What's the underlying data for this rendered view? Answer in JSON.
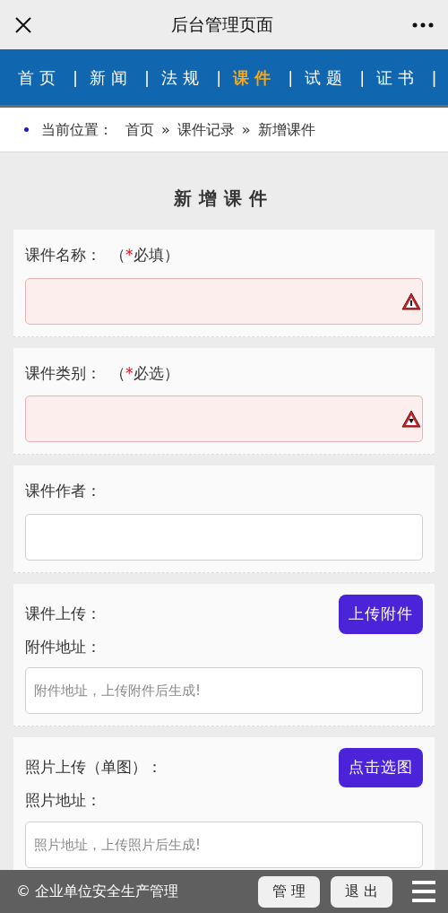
{
  "title_bar": {
    "title": "后台管理页面"
  },
  "nav": {
    "separator": "|",
    "items": [
      {
        "label": "首页",
        "selected": false
      },
      {
        "label": "新闻",
        "selected": false
      },
      {
        "label": "法规",
        "selected": false
      },
      {
        "label": "课件",
        "selected": true
      },
      {
        "label": "试题",
        "selected": false
      },
      {
        "label": "证书",
        "selected": false
      }
    ]
  },
  "breadcrumb": {
    "prefix": "当前位置：",
    "separator": "»",
    "items": [
      "首页",
      "课件记录",
      "新增课件"
    ]
  },
  "heading": "新增课件",
  "sections": [
    {
      "kind": "input",
      "label": "课件名称：",
      "note": {
        "before": "（",
        "mark": "*",
        "text": "必填）"
      },
      "invalid": true
    },
    {
      "kind": "select",
      "label": "课件类别：",
      "note": {
        "before": "（",
        "mark": "*",
        "text": "必选）"
      },
      "invalid": true
    },
    {
      "kind": "input",
      "label": "课件作者：",
      "invalid": false
    },
    {
      "kind": "upload",
      "label": "课件上传：",
      "button": "上传附件",
      "sublabel": "附件地址：",
      "placeholder": "附件地址，上传附件后生成!"
    },
    {
      "kind": "upload",
      "label": "照片上传（单图）：",
      "button": "点击选图",
      "sublabel": "照片地址：",
      "placeholder": "照片地址，上传照片后生成!"
    }
  ],
  "footer": {
    "copyright": "© 企业单位安全生产管理",
    "buttons": [
      "管 理",
      "退 出"
    ]
  }
}
